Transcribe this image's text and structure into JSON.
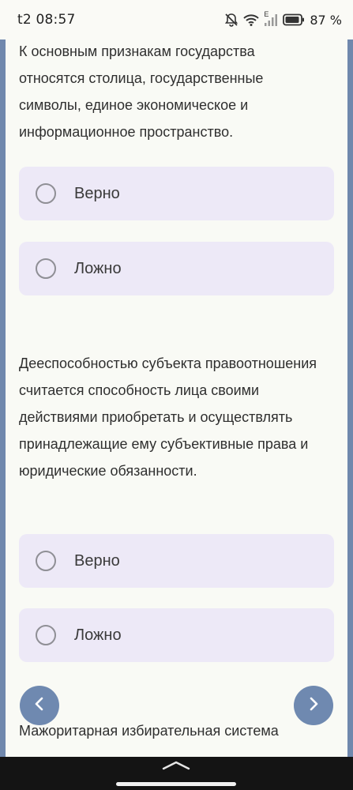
{
  "status_bar": {
    "time": "t2 08:57",
    "network_label": "E",
    "battery_percent": "87 %",
    "icons": [
      "bell-off-icon",
      "wifi-icon",
      "signal-icon",
      "battery-icon"
    ]
  },
  "questions": [
    {
      "text": "К основным признакам государства относятся столица, государственные символы, единое экономическое и информационное пространство.",
      "options": [
        "Верно",
        "Ложно"
      ]
    },
    {
      "text": "Дееспособностью субъекта правоотношения считается способность лица своими действиями приобретать и осуществлять принадлежащие ему субъективные права и юридические обязанности.",
      "options": [
        "Верно",
        "Ложно"
      ]
    },
    {
      "text": "Мажоритарная избирательная система"
    }
  ],
  "nav": {
    "prev_icon": "chevron-left-icon",
    "next_icon": "chevron-right-icon"
  },
  "colors": {
    "background": "#7088ad",
    "panel": "#f9faf5",
    "option_bg": "#ede9f7",
    "nav_button": "#6f89b0"
  }
}
